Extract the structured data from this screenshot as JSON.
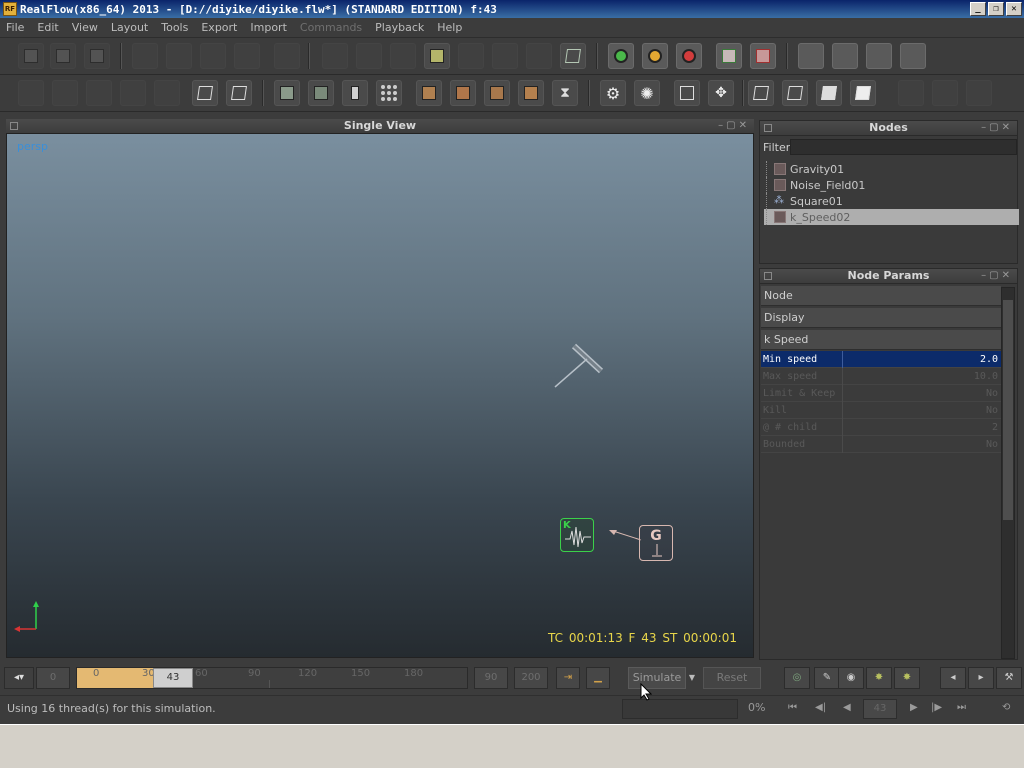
{
  "window": {
    "title": "RealFlow(x86_64) 2013 - [D://diyike/diyike.flw*] (STANDARD EDITION) f:43",
    "app_icon": "RF",
    "buttons": [
      "_",
      "❐",
      "✕"
    ]
  },
  "menu": [
    "File",
    "Edit",
    "View",
    "Layout",
    "Tools",
    "Export",
    "Import",
    "Commands",
    "Playback",
    "Help"
  ],
  "viewport": {
    "header": "Single View",
    "camera_label": "persp",
    "status": "TC 00:01:13   F 43   ST 00:00:01",
    "node_k_letter": "K",
    "node_g_letter": "G"
  },
  "nodes_panel": {
    "header": "Nodes",
    "filter_label": "Filter",
    "filter_value": "",
    "items": [
      {
        "label": "Gravity01",
        "icon": "daemon-icon"
      },
      {
        "label": "Noise_Field01",
        "icon": "daemon-icon"
      },
      {
        "label": "Square01",
        "icon": "emitter-icon"
      },
      {
        "label": "k_Speed02",
        "icon": "daemon-icon",
        "selected": true
      }
    ]
  },
  "params_panel": {
    "header": "Node Params",
    "sections": [
      "Node",
      "Display",
      "k Speed"
    ],
    "rows": [
      {
        "name": "Min speed",
        "value": "2.0",
        "selected": true
      },
      {
        "name": "Max speed",
        "value": "10.0"
      },
      {
        "name": "Limit & Keep",
        "value": "No"
      },
      {
        "name": "Kill",
        "value": "No"
      },
      {
        "name": "@ # child",
        "value": "2"
      },
      {
        "name": "Bounded",
        "value": "No"
      }
    ]
  },
  "timeline": {
    "start_field": "0",
    "ticks": [
      "0",
      "30",
      "60",
      "90",
      "120",
      "150",
      "180"
    ],
    "current_frame": "43",
    "end_field_a": "90",
    "end_field_b": "200",
    "simulate_label": "Simulate",
    "reset_label": "Reset"
  },
  "status": {
    "message": "Using 16 thread(s) for this simulation.",
    "progress": "0%",
    "frame_field": "43"
  },
  "colors": {
    "title_bar": "#0a246a",
    "viewport_label": "#3a8fd9",
    "viewport_status": "#e8d64a",
    "k_node": "#3bd14a",
    "selection": "#0c2b6a",
    "timeline_fill": "#e4b972"
  }
}
